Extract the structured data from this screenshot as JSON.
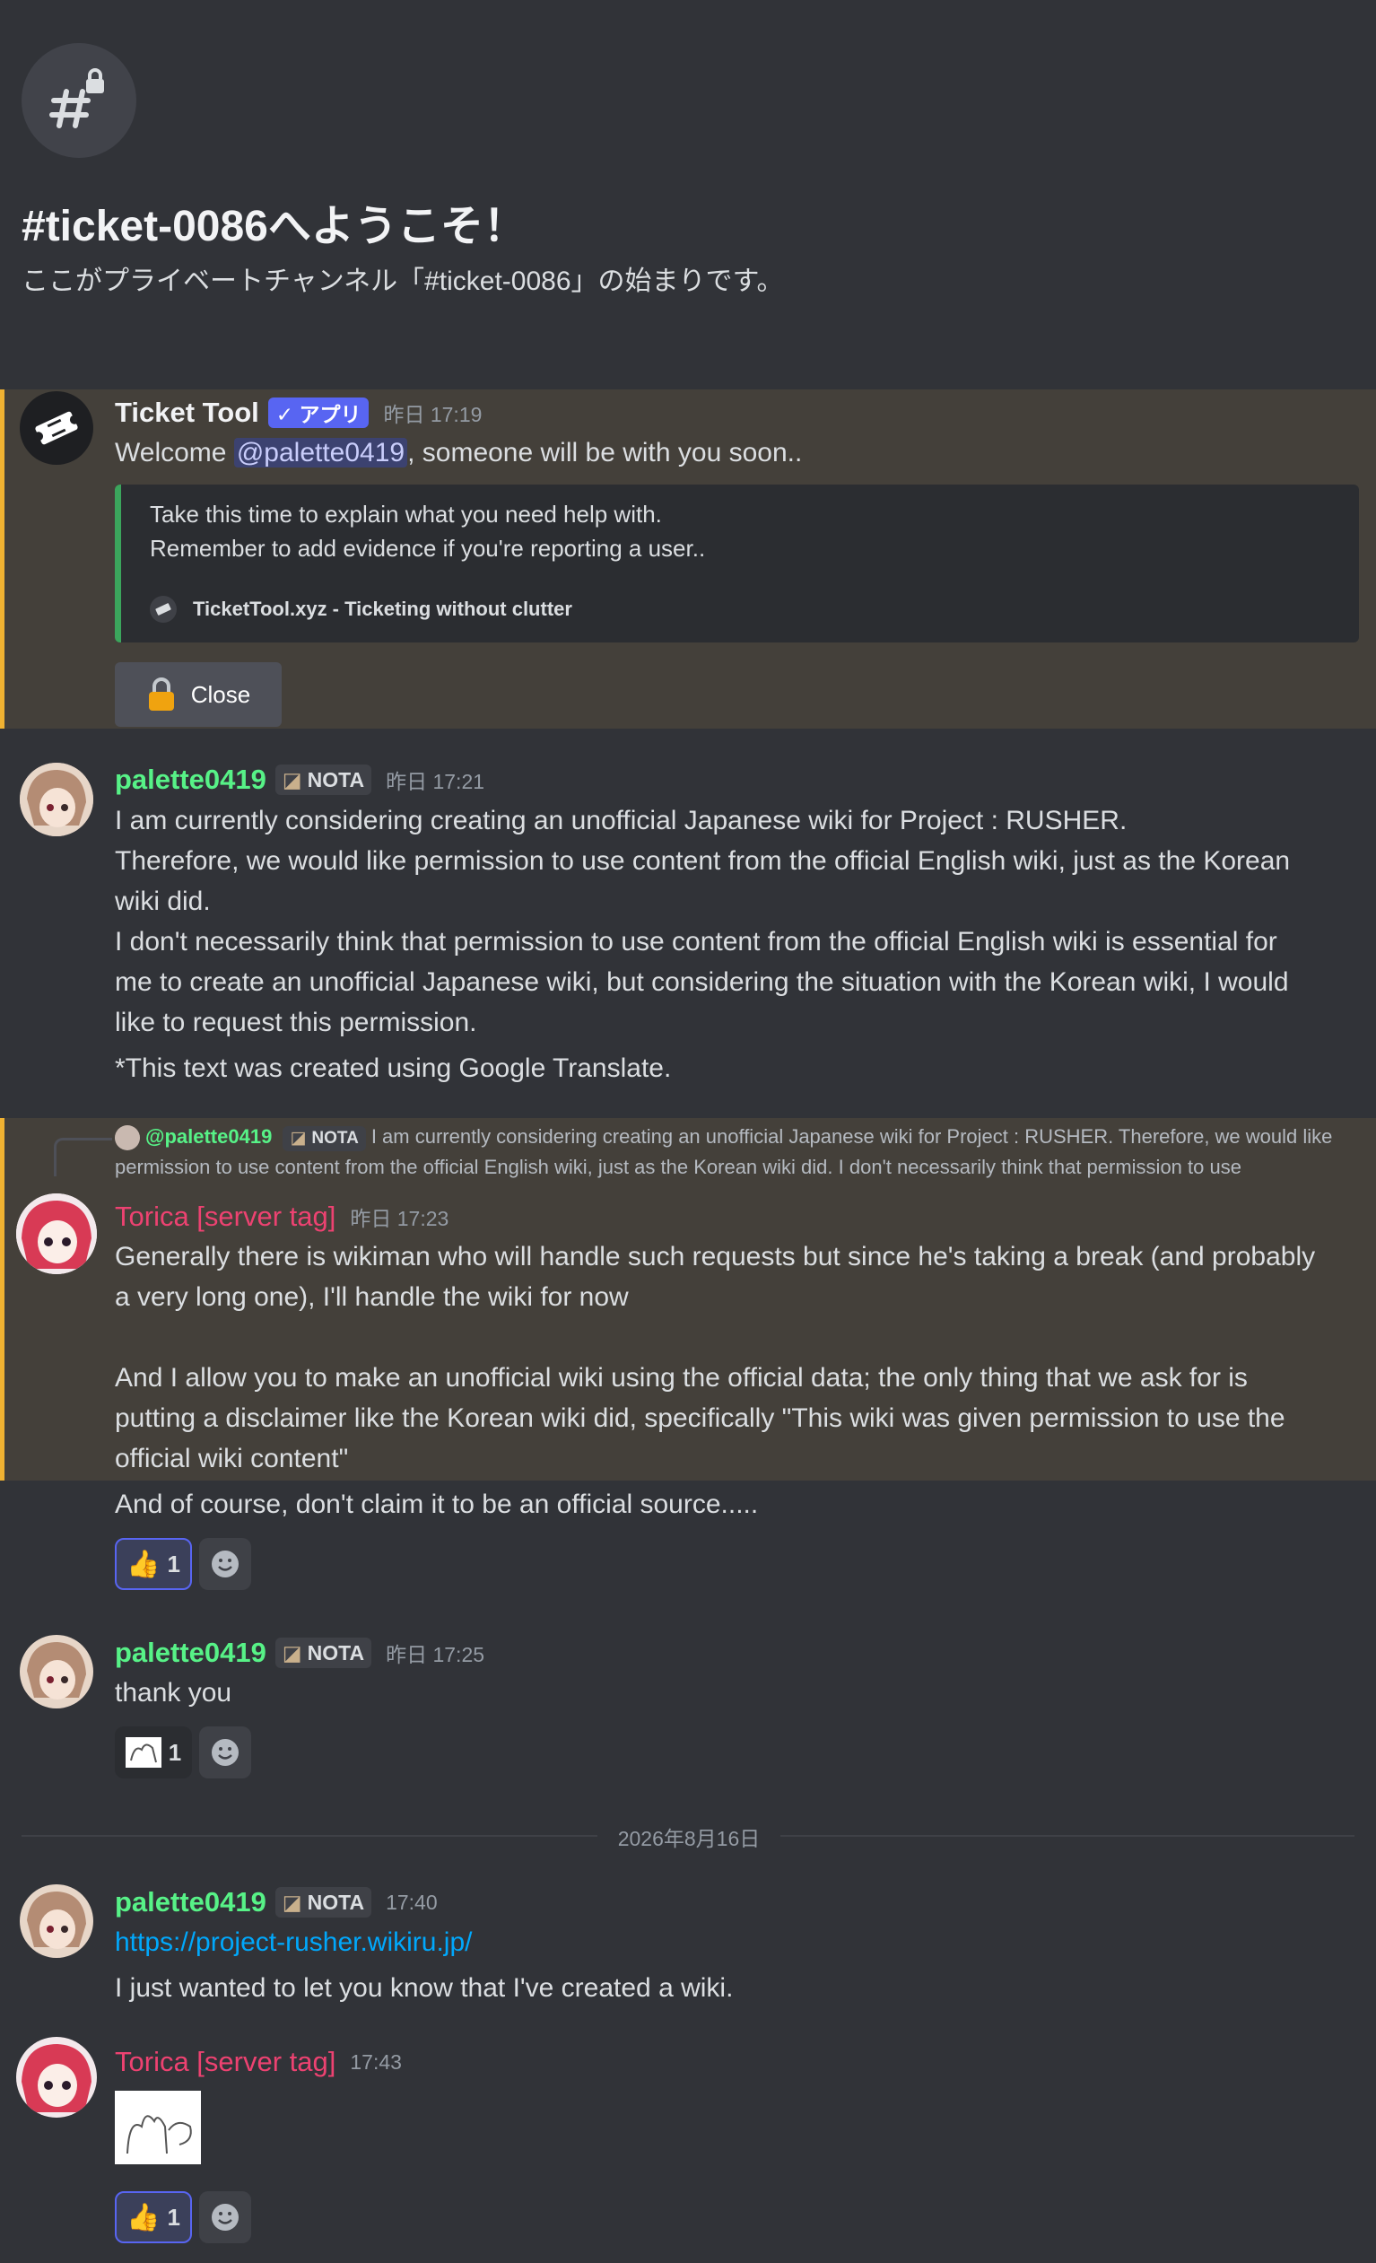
{
  "channel": {
    "title": "#ticket-0086へようこそ！",
    "subtitle": "ここがプライベートチャンネル「#ticket-0086」の始まりです。"
  },
  "messages": [
    {
      "author": "Ticket Tool",
      "app_badge": "✓ アプリ",
      "time": "昨日 17:19",
      "text_pre": "Welcome ",
      "mention": "@palette0419",
      "text_post": ", someone will be with you soon..",
      "embed": {
        "line1": "Take this time to explain what you need help with.",
        "line2": "Remember to add evidence if you're reporting a user..",
        "footer": "TicketTool.xyz - Ticketing without clutter"
      },
      "button_label": "Close"
    },
    {
      "author": "palette0419",
      "tag": "NOTA",
      "time": "昨日 17:21",
      "lines": [
        "I am currently considering creating an unofficial Japanese wiki for Project : RUSHER.",
        "Therefore, we would like permission to use content from the official English wiki, just as the Korean",
        "wiki did.",
        "I don't necessarily think that permission to use content from the official English wiki is essential for",
        "me to create an unofficial Japanese wiki, but considering the situation with the Korean wiki, I would",
        "like to request this permission.",
        "*This text was created using Google Translate."
      ]
    },
    {
      "reply_author": "@palette0419",
      "reply_tag": "NOTA",
      "reply_text": "I am currently considering creating an unofficial Japanese wiki for Project : RUSHER. Therefore, we would like permission to use content from the official English wiki, just as the Korean wiki did. I don't necessarily think that permission to use",
      "author": "Torica [server tag]",
      "time": "昨日 17:23",
      "lines": [
        "Generally there is wikiman who will handle such requests but since he's taking a break (and probably",
        "a very long one), I'll handle the wiki for now",
        "",
        "And I allow you to make an unofficial wiki using the official data; the only thing that we ask for is",
        "putting a disclaimer like the Korean wiki did, specifically \"This wiki was given permission to use the",
        "official wiki content\"",
        "And of course, don't claim it to be an official source....."
      ],
      "reaction_count": "1"
    },
    {
      "author": "palette0419",
      "tag": "NOTA",
      "time": "昨日 17:25",
      "text": "thank you",
      "reaction_count": "1"
    },
    {
      "author": "palette0419",
      "tag": "NOTA",
      "time": "17:40",
      "link": "https://project-rusher.wikiru.jp/",
      "text": "I just wanted to let you know that I've created a wiki."
    },
    {
      "author": "Torica [server tag]",
      "time": "17:43",
      "reaction_count": "1"
    }
  ],
  "date_divider": "2026年8月16日",
  "colors": {
    "palette_name": "#57f287",
    "torica_name": "#ed4271",
    "ticket_name": "#f2f3f5",
    "highlight_bar": "#f0b232",
    "embed_bar": "#3ba55c"
  }
}
